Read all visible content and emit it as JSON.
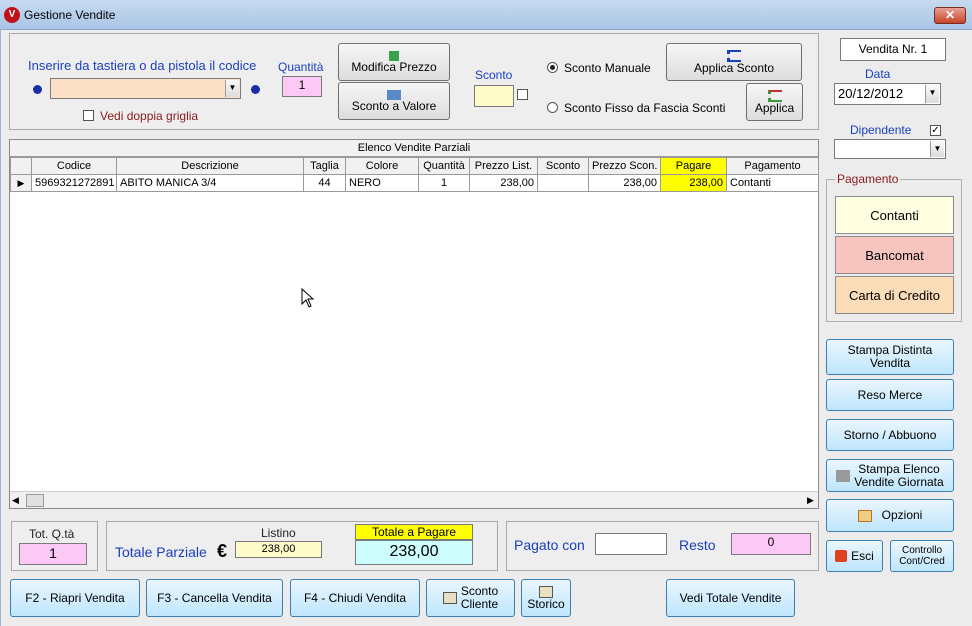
{
  "window": {
    "title": "Gestione Vendite",
    "close_glyph": "✕"
  },
  "entry": {
    "prompt": "Inserire da tastiera o da pistola il codice",
    "code_value": "",
    "dup_grid_label": "Vedi doppia griglia",
    "quantity_label": "Quantità",
    "quantity_value": "1"
  },
  "buttons": {
    "modifica_prezzo": "Modifica Prezzo",
    "sconto_valore": "Sconto a Valore",
    "applica_sconto": "Applica Sconto",
    "applica": "Applica",
    "f2": "F2 - Riapri Vendita",
    "f3": "F3 - Cancella Vendita",
    "f4": "F4 - Chiudi Vendita",
    "sconto_cliente_1": "Sconto",
    "sconto_cliente_2": "Cliente",
    "storico": "Storico",
    "vedi_totale": "Vedi Totale Vendite",
    "stampa_distinta_1": "Stampa Distinta",
    "stampa_distinta_2": "Vendita",
    "reso_merce": "Reso Merce",
    "storno": "Storno / Abbuono",
    "stampa_elenco_1": "Stampa Elenco",
    "stampa_elenco_2": "Vendite Giornata",
    "opzioni": "Opzioni",
    "esci": "Esci",
    "controllo_1": "Controllo",
    "controllo_2": "Cont/Cred"
  },
  "discount": {
    "label": "Sconto",
    "value": "",
    "manual_label": "Sconto Manuale",
    "fixed_label": "Sconto Fisso da Fascia Sconti"
  },
  "grid": {
    "caption": "Elenco Vendite Parziali",
    "columns": [
      "Codice",
      "Descrizione",
      "Taglia",
      "Colore",
      "Quantità",
      "Prezzo List.",
      "Sconto",
      "Prezzo Scon.",
      "Pagare",
      "Pagamento"
    ],
    "rows": [
      {
        "codice": "5969321272891",
        "descrizione": "ABITO MANICA 3/4",
        "taglia": "44",
        "colore": "NERO",
        "quantita": "1",
        "prezzo_list": "238,00",
        "sconto": "",
        "prezzo_scon": "238,00",
        "pagare": "238,00",
        "pagamento": "Contanti"
      }
    ]
  },
  "sidebar": {
    "vendita_nr": "Vendita Nr.  1",
    "data_label": "Data",
    "data_value": "20/12/2012",
    "dipendente_label": "Dipendente",
    "dipendente_value": "",
    "pagamento_label": "Pagamento",
    "contanti": "Contanti",
    "bancomat": "Bancomat",
    "carta": "Carta di Credito"
  },
  "totals": {
    "tot_qta_label": "Tot. Q.tà",
    "tot_qta_value": "1",
    "totale_parziale_label": "Totale Parziale",
    "euro": "€",
    "listino_label": "Listino",
    "listino_value": "238,00",
    "totale_pagare_label": "Totale a Pagare",
    "totale_pagare_value": "238,00",
    "pagato_con_label": "Pagato con",
    "pagato_con_value": "",
    "resto_label": "Resto",
    "resto_value": "0"
  },
  "colors": {
    "pink": "#fcc8f5",
    "light_yellow": "#fdfbc8",
    "yellow": "#ffff00",
    "cyan": "#ccfcfc",
    "contanti_bg": "#fefee0",
    "bancomat_bg": "#f7c4c0",
    "carta_bg": "#fbdcb8",
    "code_bg": "#fde1c6",
    "blue_label": "#1a3fbf",
    "red_label": "#8b1a1a"
  }
}
